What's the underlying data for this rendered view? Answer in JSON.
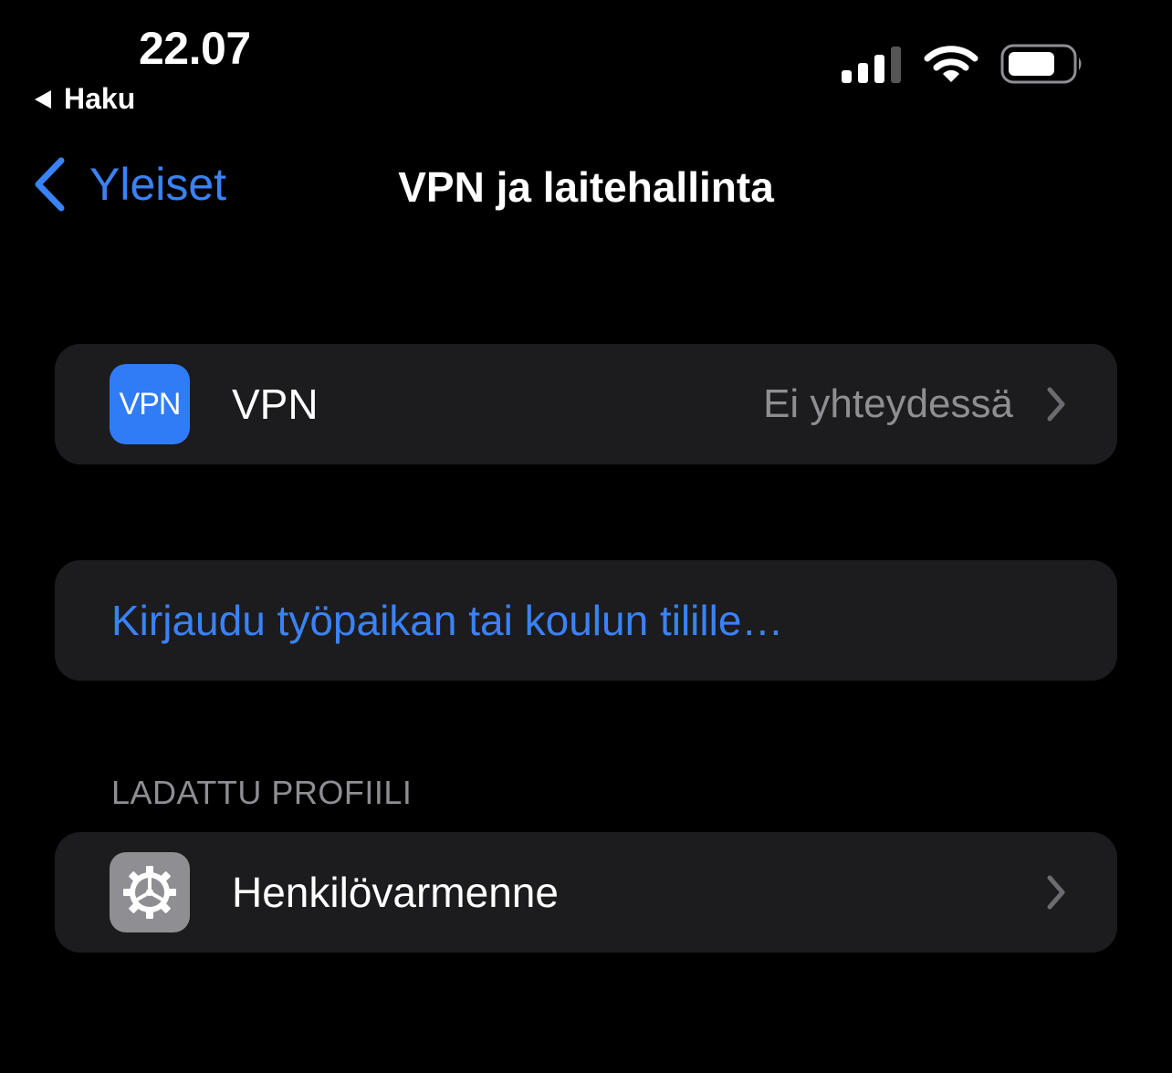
{
  "status_bar": {
    "time": "22.07",
    "back_app": "Haku",
    "icons": [
      "cellular-signal-icon",
      "wifi-icon",
      "battery-icon"
    ]
  },
  "nav": {
    "back_label": "Yleiset",
    "title": "VPN ja laitehallinta"
  },
  "vpn_group": {
    "icon_text": "VPN",
    "label": "VPN",
    "value": "Ei yhteydessä"
  },
  "signin_group": {
    "link": "Kirjaudu työpaikan tai koulun tilille…"
  },
  "profile_section": {
    "header": "LADATTU PROFIILI",
    "items": [
      {
        "label": "Henkilövarmenne",
        "icon": "gear-icon"
      }
    ]
  },
  "colors": {
    "background": "#000000",
    "cell": "#1c1c1e",
    "accent": "#3a82f7",
    "secondary_text": "#8e8e93",
    "vpn_icon": "#2f7cf6"
  }
}
